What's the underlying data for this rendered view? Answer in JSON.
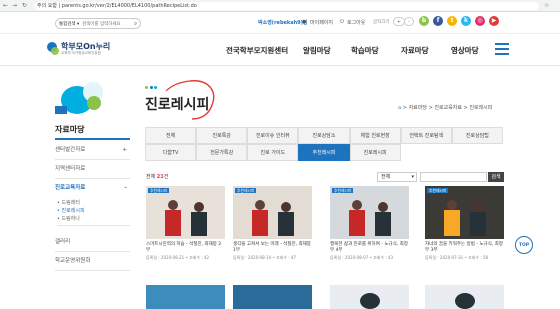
{
  "browser": {
    "url": "주의 요함 | parents.go.kr/ver/2/EL4000/EL4100/pathRecipeList.do"
  },
  "topbar": {
    "search_placeholder": "검색어를 입력하세요",
    "user_label": "박소영(rebekah9)님",
    "links": [
      "마이페이지",
      "로그아웃"
    ],
    "font_label": "글자크기",
    "font_plus": "+",
    "font_minus": "-",
    "social_icons": [
      "blog-icon",
      "facebook-icon",
      "twitter-icon",
      "kakao-icon",
      "instagram-icon",
      "youtube-icon"
    ],
    "social_colors": [
      "#8bc34a",
      "#3b5998",
      "#f4b400",
      "#29b6f6",
      "#e1306c",
      "#e53935"
    ],
    "social_glyphs": [
      "b",
      "f",
      "t",
      "k",
      "◎",
      "▶"
    ]
  },
  "header": {
    "logo_text": "학부모On누리",
    "logo_sub": "교육부·국가평생교육진흥원",
    "gnb": [
      "전국학부모지원센터",
      "알림마당",
      "학습마당",
      "자료마당",
      "영상마당"
    ]
  },
  "page": {
    "title": "진로레시피",
    "breadcrumb": [
      "자료마당",
      "진로교육자료",
      "진로레시피"
    ]
  },
  "sidebar": {
    "heading": "자료마당",
    "items": [
      {
        "label": "센터발간자료",
        "toggle": "+"
      },
      {
        "label": "지역센터자료",
        "toggle": ""
      },
      {
        "label": "진로교육자료",
        "toggle": "–",
        "active": true
      },
      {
        "label": "드림레터",
        "toggle": ""
      },
      {
        "label": "진로레시피",
        "toggle": ""
      },
      {
        "label": "드림하나",
        "toggle": ""
      },
      {
        "label": "갤러리",
        "toggle": ""
      },
      {
        "label": "학교운영위원회",
        "toggle": ""
      }
    ]
  },
  "tabs": {
    "row1": [
      "전체",
      "진로특강",
      "진로이슈 인터뷰",
      "진로상담소",
      "체험 진로현장",
      "언택트 진로탐색",
      "진로상담팁"
    ],
    "row2": [
      "다함TV",
      "전문가특강",
      "진로 가이드",
      "추천레시피",
      "진로레시피"
    ],
    "active": "추천레시피"
  },
  "list": {
    "total_label": "전체",
    "total_count": "21",
    "total_unit": "건",
    "select_value": "전체",
    "search_button": "검색"
  },
  "cards": [
    {
      "badge": "추천레시피",
      "title": "스마트시민력의 학습 - 석철진, 최재봉 2부",
      "meta": "등록일 : 2020-08-21  •  조회수 : 42"
    },
    {
      "badge": "추천레시피",
      "title": "생각을 고쳐서 보는 미래 - 석철진, 최재봉 1부",
      "meta": "등록일 : 2020-08-14  •  조회수 : 47"
    },
    {
      "badge": "추천레시피",
      "title": "행복한 삶과 진로를 위하여 - 노규식, 최정부 4부",
      "meta": "등록일 : 2020-08-07  •  조회수 : 43"
    },
    {
      "badge": "추천레시피",
      "title": "자녀의 꿈을 키워주는 방법 - 노규식, 최정부 3부",
      "meta": "등록일 : 2020-07-31  •  조회수 : 58"
    }
  ],
  "top_button": "TOP"
}
